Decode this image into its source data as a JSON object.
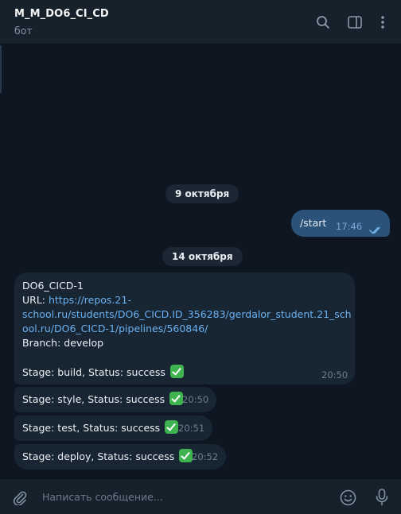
{
  "header": {
    "title": "M_M_DO6_CI_CD",
    "subtitle": "бот"
  },
  "feed": {
    "dates": [
      "9 октября",
      "14 октября"
    ],
    "outgoing": {
      "text": "/start",
      "time": "17:46"
    },
    "pipeline": {
      "name": "DO6_CICD-1",
      "url_label": "URL: ",
      "url_line1": "https://repos.21-",
      "url_line2": "school.ru/students/DO6_CICD.ID_356283/gerdalor_student.21_sch",
      "url_line3": "ool.ru/DO6_CICD-1/pipelines/560846/",
      "branch": "Branch: develop",
      "stage_build": "Stage: build, Status: success",
      "time": "20:50"
    },
    "stages": [
      {
        "text": "Stage: style, Status: success",
        "time": "20:50"
      },
      {
        "text": "Stage: test, Status: success",
        "time": "20:51"
      },
      {
        "text": "Stage: deploy, Status: success",
        "time": "20:52"
      }
    ]
  },
  "composer": {
    "placeholder": "Написать сообщение..."
  },
  "icons": [
    "search-icon",
    "sidebar-toggle-icon",
    "more-vertical-icon",
    "attach-icon",
    "emoji-icon",
    "microphone-icon",
    "double-check-icon",
    "checkmark-emoji-icon"
  ],
  "colors": {
    "accent": "#6ab2f2",
    "outgoing_bubble": "#2b5278",
    "incoming_bubble": "#182533",
    "check_green": "#3eb34f"
  }
}
